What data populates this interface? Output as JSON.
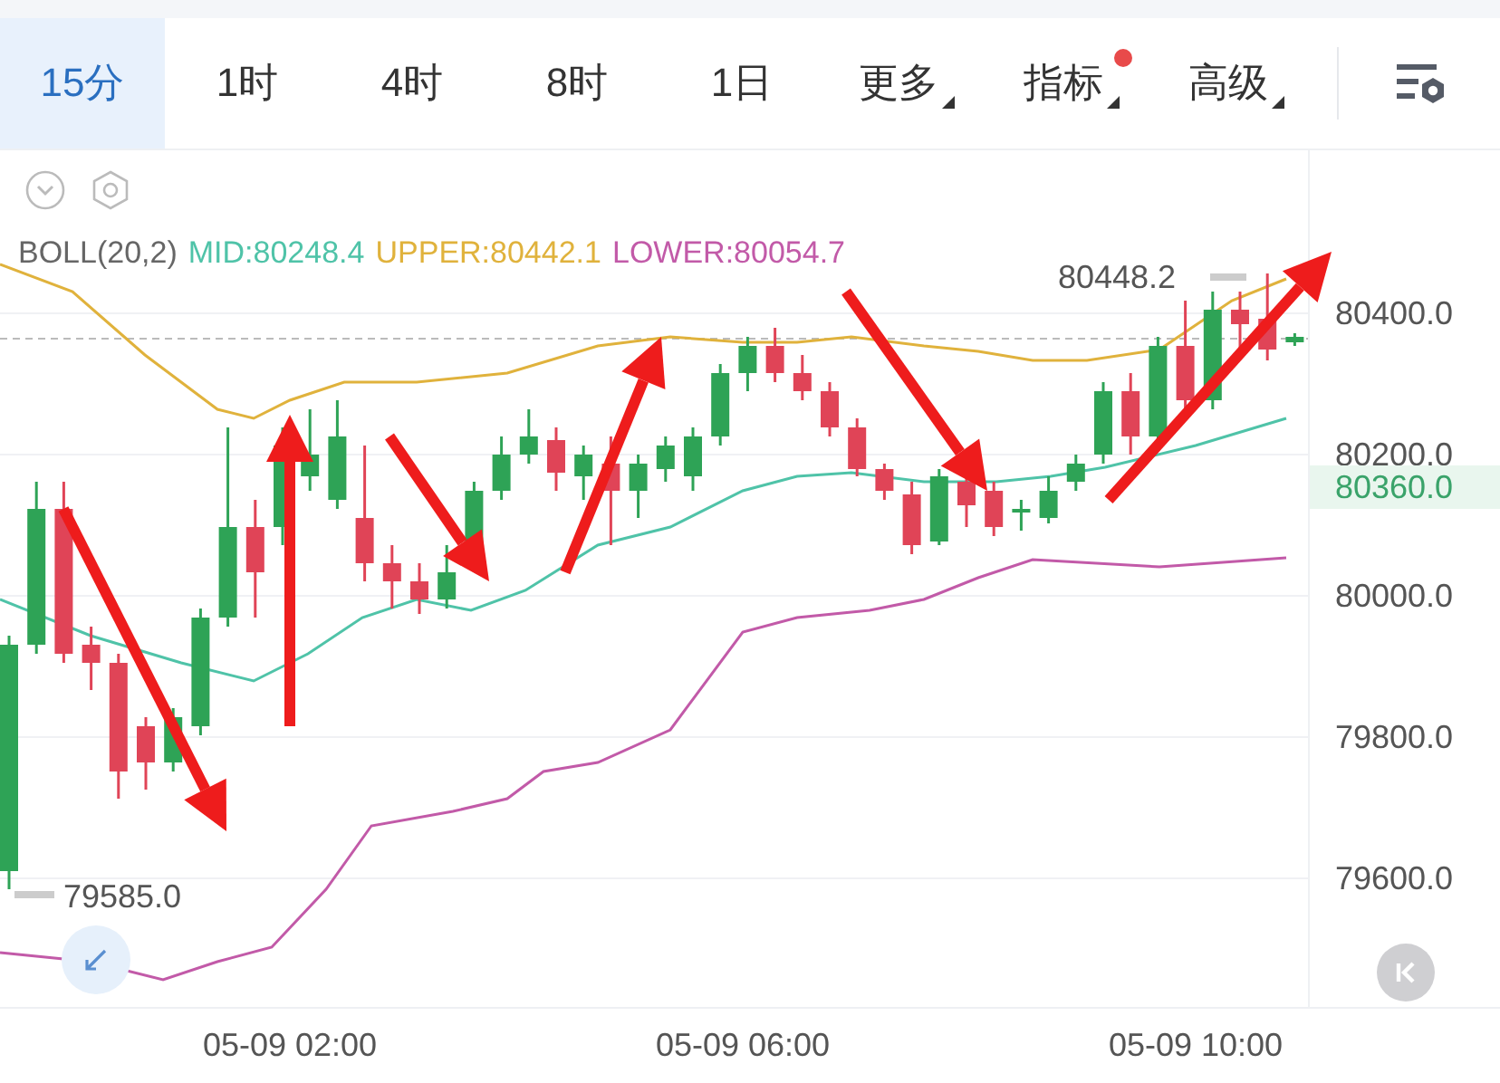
{
  "tabs": [
    {
      "label": "15分",
      "kind": "interval",
      "selected": true,
      "badge": false
    },
    {
      "label": "1时",
      "kind": "interval",
      "selected": false,
      "badge": false
    },
    {
      "label": "4时",
      "kind": "interval",
      "selected": false,
      "badge": false
    },
    {
      "label": "8时",
      "kind": "interval",
      "selected": false,
      "badge": false
    },
    {
      "label": "1日",
      "kind": "interval",
      "selected": false,
      "badge": false
    },
    {
      "label": "更多",
      "kind": "menu",
      "selected": false,
      "badge": false
    },
    {
      "label": "指标",
      "kind": "menu",
      "selected": false,
      "badge": true
    },
    {
      "label": "高级",
      "kind": "menu",
      "selected": false,
      "badge": false
    }
  ],
  "indicator": {
    "name": "BOLL(20,2)",
    "mid": "MID:80248.4",
    "upper": "UPPER:80442.1",
    "lower": "LOWER:80054.7"
  },
  "chart": {
    "high_label": "80448.2",
    "low_label": "79585.0",
    "current_price": "80360.0",
    "y_axis": [
      "80400.0",
      "80200.0",
      "80000.0",
      "79800.0",
      "79600.0"
    ],
    "x_axis": [
      "05-09 02:00",
      "05-09 06:00",
      "05-09 10:00"
    ]
  }
}
